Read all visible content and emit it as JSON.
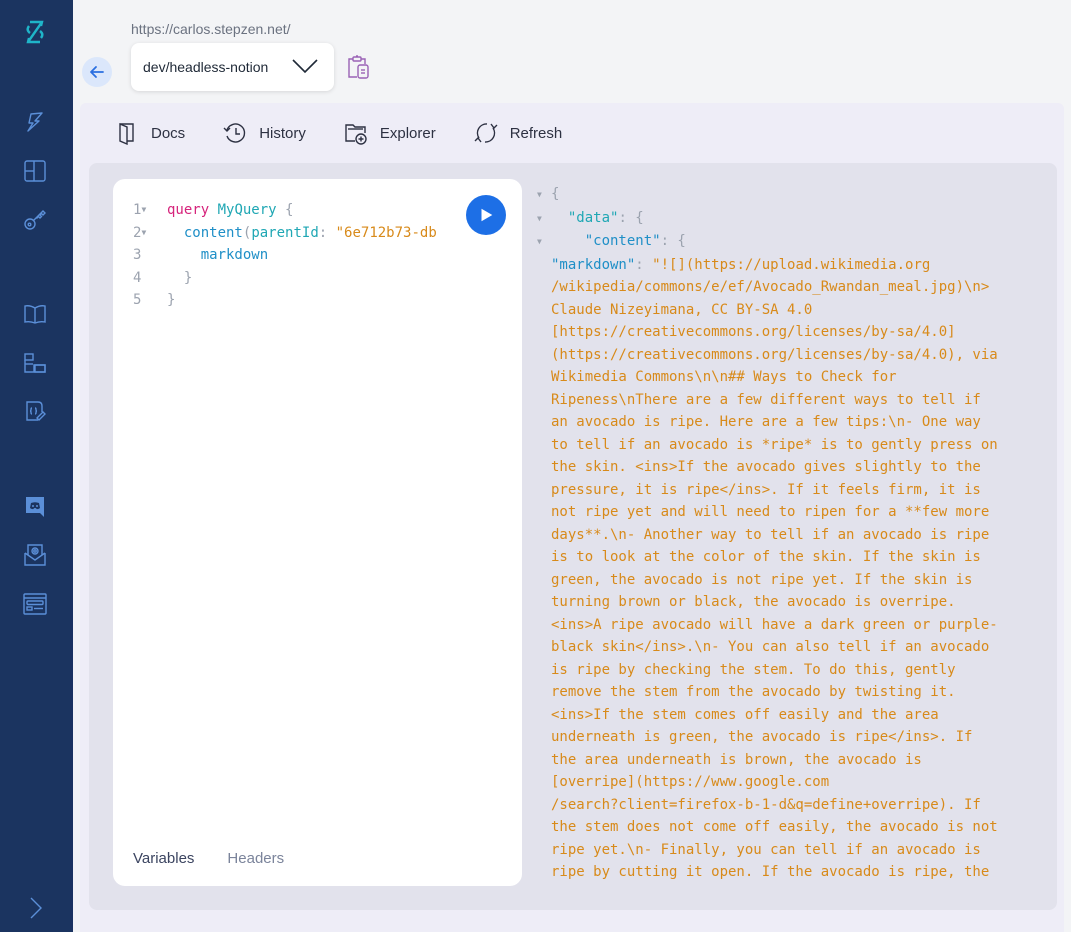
{
  "sidebar": {
    "logo": "stepzen-logo-icon",
    "items": [
      {
        "name": "sidebar-item-quickstart",
        "icon": "bolt-icon"
      },
      {
        "name": "sidebar-item-dashboard",
        "icon": "layout-icon"
      },
      {
        "name": "sidebar-item-keys",
        "icon": "key-icon"
      },
      {
        "name": "sidebar-item-docs",
        "icon": "book-icon"
      },
      {
        "name": "sidebar-item-blocks",
        "icon": "blocks-icon"
      },
      {
        "name": "sidebar-item-schema",
        "icon": "code-file-icon"
      },
      {
        "name": "sidebar-item-discord",
        "icon": "discord-icon"
      },
      {
        "name": "sidebar-item-contact",
        "icon": "mail-icon"
      },
      {
        "name": "sidebar-item-blog",
        "icon": "browser-icon"
      }
    ],
    "expand_icon": "chevron-right-icon"
  },
  "header": {
    "url": "https://carlos.stepzen.net/",
    "endpoint": "dev/headless-notion"
  },
  "toolbar": {
    "docs": "Docs",
    "history": "History",
    "explorer": "Explorer",
    "refresh": "Refresh"
  },
  "editor": {
    "lines": [
      {
        "num": "1",
        "kw": "query",
        "name": "MyQuery",
        "open": "{"
      },
      {
        "num": "2",
        "field": "content",
        "arg": "parentId",
        "value": "\"6e712b73-db"
      },
      {
        "num": "3",
        "field": "markdown"
      },
      {
        "num": "4",
        "close": "}"
      },
      {
        "num": "5",
        "close": "}"
      }
    ],
    "tabs": {
      "variables": "Variables",
      "headers": "Headers"
    }
  },
  "result": {
    "open": "{",
    "data_key": "\"data\"",
    "content_key": "\"content\"",
    "markdown_key": "\"markdown\"",
    "markdown_value": "\"![](https://upload.wikimedia.org\n/wikipedia/commons/e/ef/Avocado_Rwandan_meal.jpg)\\n>\nClaude Nizeyimana, CC BY-SA 4.0\n[https://creativecommons.org/licenses/by-sa/4.0]\n(https://creativecommons.org/licenses/by-sa/4.0), via\nWikimedia Commons\\n\\n## Ways to Check for\nRipeness\\nThere are a few different ways to tell if\nan avocado is ripe. Here are a few tips:\\n- One way\nto tell if an avocado is *ripe* is to gently press on\nthe skin. <ins>If the avocado gives slightly to the\npressure, it is ripe</ins>. If it feels firm, it is\nnot ripe yet and will need to ripen for a **few more\ndays**.\\n- Another way to tell if an avocado is ripe\nis to look at the color of the skin. If the skin is\ngreen, the avocado is not ripe yet. If the skin is\nturning brown or black, the avocado is overripe.\n<ins>A ripe avocado will have a dark green or purple-\nblack skin</ins>.\\n- You can also tell if an avocado\nis ripe by checking the stem. To do this, gently\nremove the stem from the avocado by twisting it.\n<ins>If the stem comes off easily and the area\nunderneath is green, the avocado is ripe</ins>. If\nthe area underneath is brown, the avocado is\n[overripe](https://www.google.com\n/search?client=firefox-b-1-d&q=define+overripe). If\nthe stem does not come off easily, the avocado is not\nripe yet.\\n- Finally, you can tell if an avocado is\nripe by cutting it open. If the avocado is ripe, the"
  },
  "colors": {
    "sidebar_bg": "#1b3460",
    "accent_blue": "#1d6fe6",
    "logo_teal": "#1fb5c9",
    "string_orange": "#d88a1a",
    "keyword_pink": "#d6247c"
  }
}
